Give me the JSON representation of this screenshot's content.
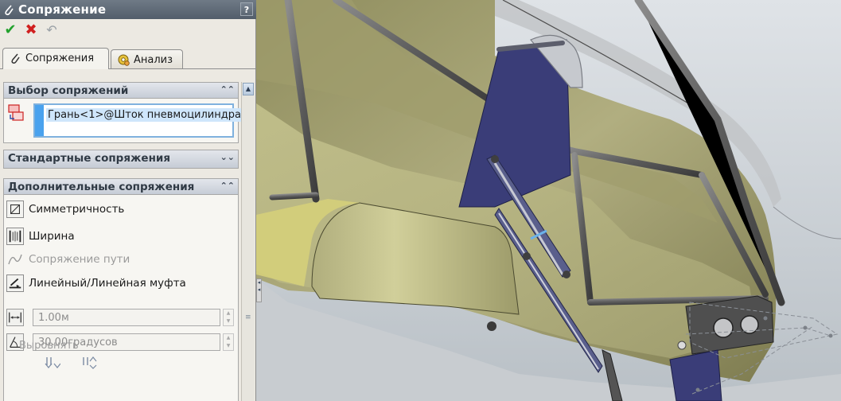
{
  "window": {
    "title": "Сопряжение",
    "help": "?"
  },
  "actions": {
    "ok": "✔",
    "cancel": "✖",
    "undo": "↶"
  },
  "tabs": [
    {
      "label": "Сопряжения"
    },
    {
      "label": "Анализ"
    }
  ],
  "sections": {
    "selection": {
      "title": "Выбор сопряжений",
      "chevron": "⌃⌃",
      "selected_item": "Грань<1>@Шток пневмоцилиндра"
    },
    "standard": {
      "title": "Стандартные сопряжения",
      "chevron": "⌄⌄"
    },
    "advanced": {
      "title": "Дополнительные сопряжения",
      "chevron": "⌃⌃",
      "items": [
        {
          "label": "Симметричность",
          "enabled": true
        },
        {
          "label": "Ширина",
          "enabled": true
        },
        {
          "label": "Сопряжение пути",
          "enabled": false
        },
        {
          "label": "Линейный/Линейная муфта",
          "enabled": true
        }
      ],
      "distance_value": "1.00м",
      "angle_value": "30.00градусов",
      "align_label": "Выровнять"
    }
  },
  "colors": {
    "panel_bg": "#ece9e2",
    "titlebar": "#5e6975",
    "selection_border": "#7fb1de",
    "model_body": "#a9a77c",
    "bracket": "#3a3d78"
  }
}
